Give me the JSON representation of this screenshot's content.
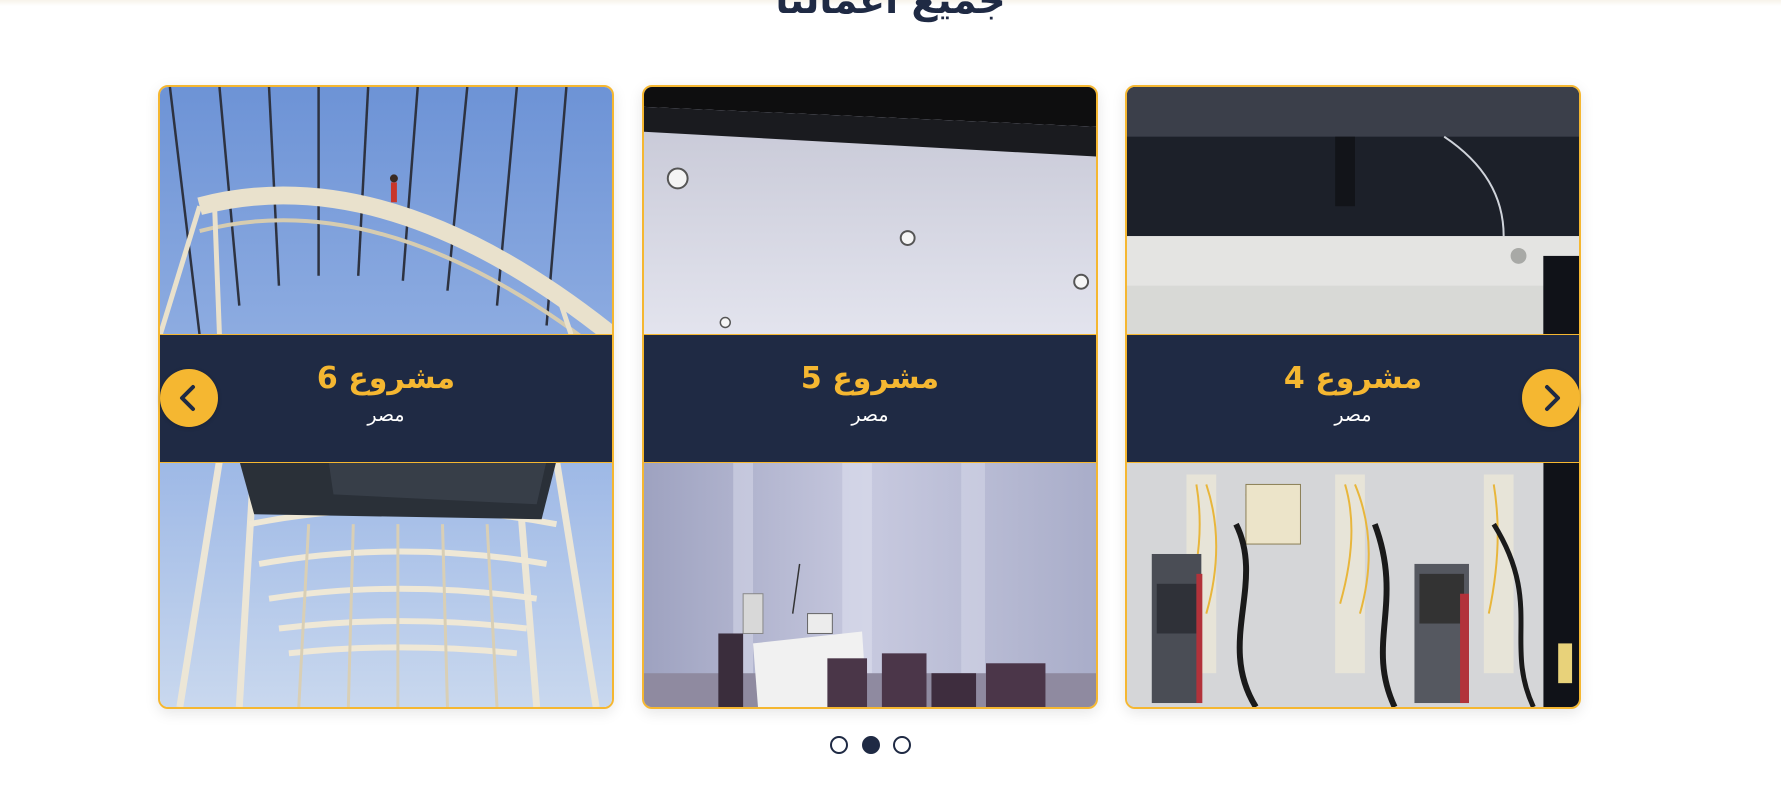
{
  "section": {
    "title": "جميع أعمالنا"
  },
  "projects": [
    {
      "title": "مشروع 6",
      "location": "مصر",
      "image": "steel-roof-trusses-photo"
    },
    {
      "title": "مشروع 5",
      "location": "مصر",
      "image": "office-interior-photo"
    },
    {
      "title": "مشروع 4",
      "location": "مصر",
      "image": "electrical-panel-photo"
    }
  ],
  "carousel": {
    "prev_icon": "chevron-left-icon",
    "next_icon": "chevron-right-icon",
    "pages": 3,
    "active_page": 2
  },
  "colors": {
    "accent": "#f5b731",
    "navy": "#1f2a44",
    "background": "#ffffff"
  }
}
